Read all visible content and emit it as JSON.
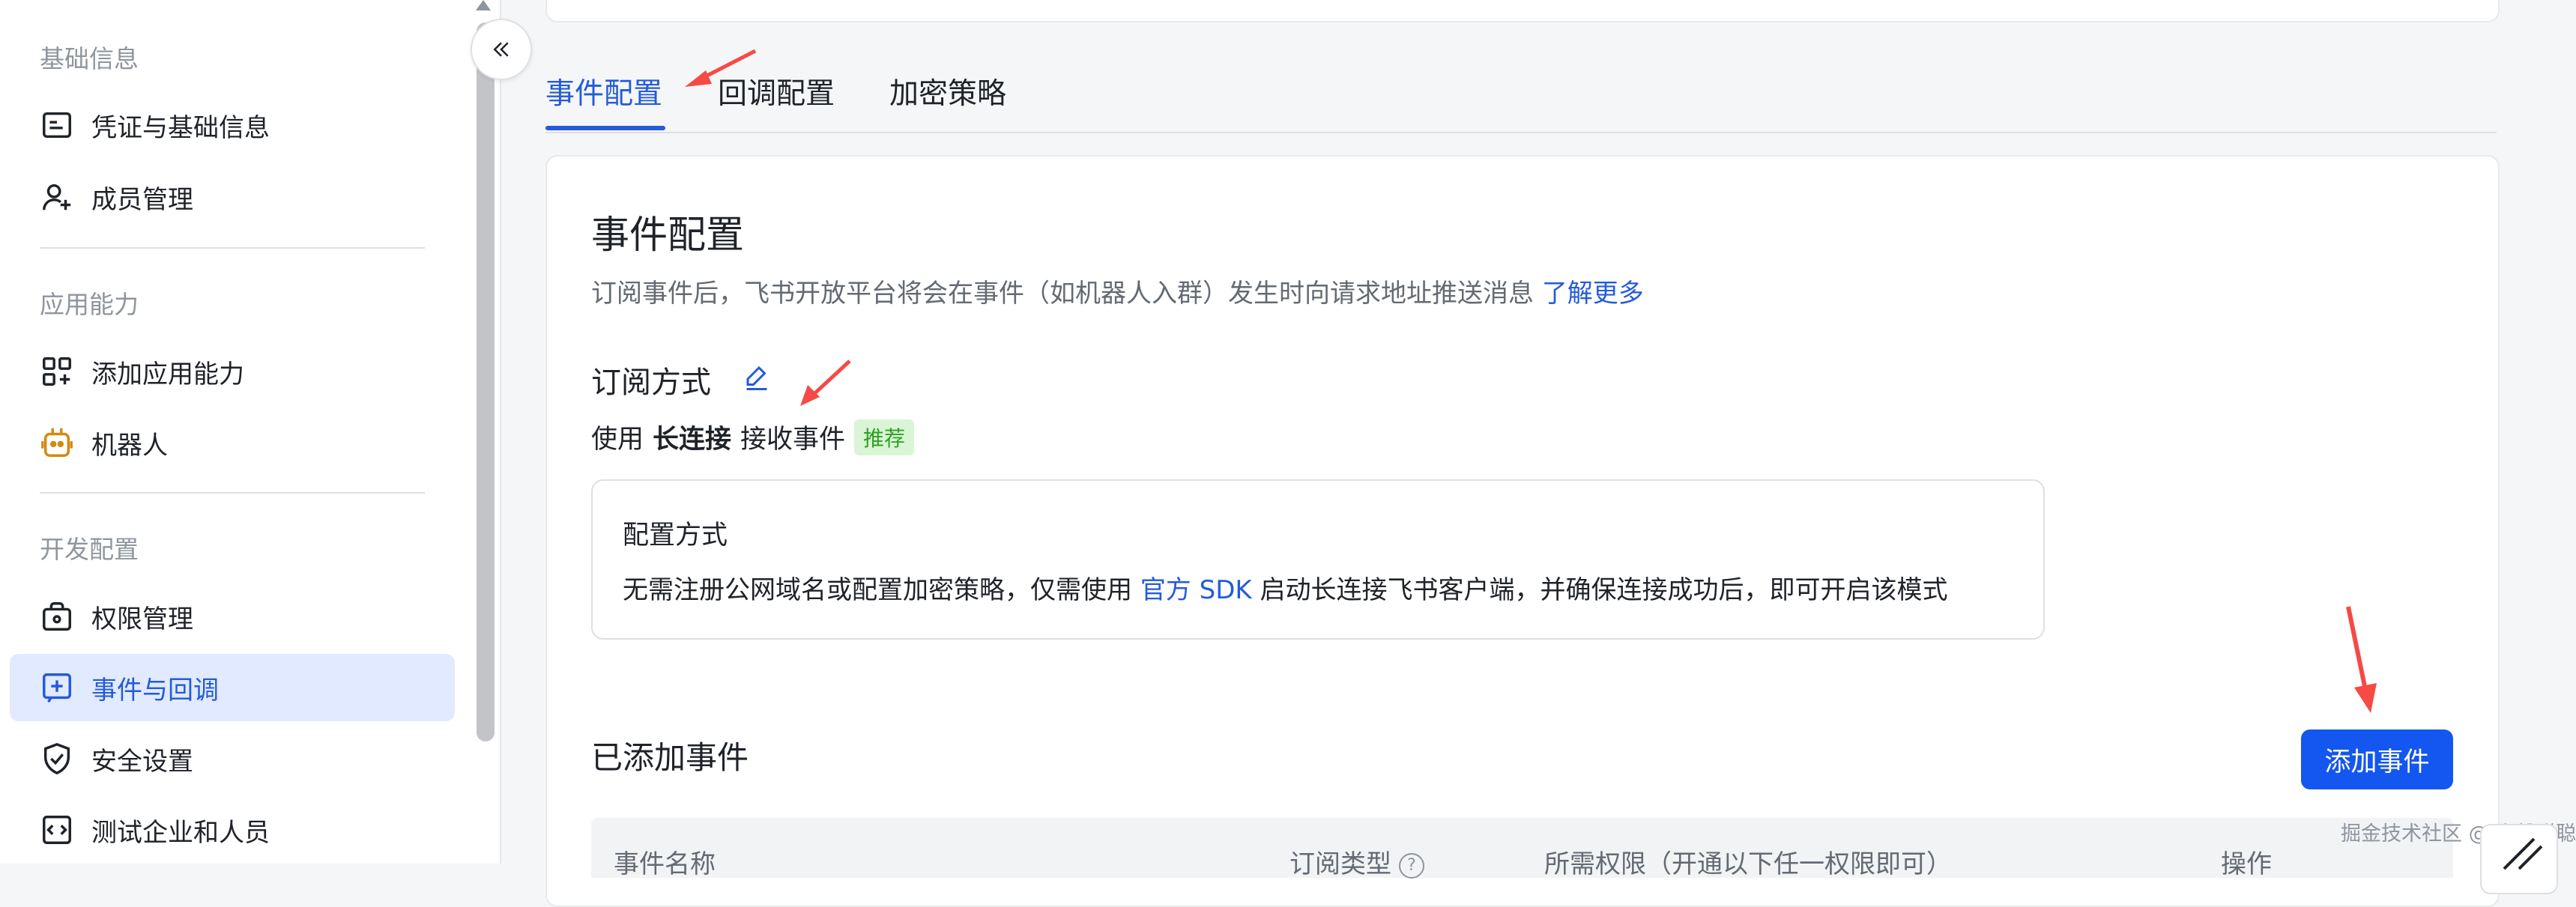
{
  "sidebar": {
    "groups": [
      {
        "title": "基础信息",
        "items": [
          {
            "label": "凭证与基础信息",
            "icon": "credential-icon"
          },
          {
            "label": "成员管理",
            "icon": "add-member-icon"
          }
        ]
      },
      {
        "title": "应用能力",
        "items": [
          {
            "label": "添加应用能力",
            "icon": "add-capability-icon"
          },
          {
            "label": "机器人",
            "icon": "robot-icon"
          }
        ]
      },
      {
        "title": "开发配置",
        "items": [
          {
            "label": "权限管理",
            "icon": "permission-icon"
          },
          {
            "label": "事件与回调",
            "icon": "event-callback-icon",
            "active": true
          },
          {
            "label": "安全设置",
            "icon": "shield-check-icon"
          },
          {
            "label": "测试企业和人员",
            "icon": "code-test-icon"
          }
        ]
      }
    ],
    "collapse_icon": "double-chevron-left-icon"
  },
  "tabs": [
    {
      "label": "事件配置",
      "active": true
    },
    {
      "label": "回调配置"
    },
    {
      "label": "加密策略"
    }
  ],
  "event_config": {
    "title": "事件配置",
    "description": "订阅事件后，飞书开放平台将会在事件（如机器人入群）发生时向请求地址推送消息",
    "learn_more": "了解更多",
    "subscription_label": "订阅方式",
    "using_prefix": "使用",
    "using_method": "长连接",
    "using_suffix": "接收事件",
    "recommend_badge": "推荐",
    "config_box": {
      "title": "配置方式",
      "text_before": "无需注册公网域名或配置加密策略，仅需使用",
      "link": "官方 SDK",
      "text_after": "启动长连接飞书客户端，并确保连接成功后，即可开启该模式"
    }
  },
  "added_events": {
    "title": "已添加事件",
    "add_button": "添加事件",
    "columns": [
      "事件名称",
      "订阅类型",
      "所需权限（开通以下任一权限即可）",
      "操作"
    ],
    "help_icon_text": "?"
  },
  "watermark": "掘金技术社区 @ 小馨聪聪",
  "colors": {
    "accent": "#245bdb",
    "primary_button": "#1456f0",
    "active_nav_bg": "#e1eaff",
    "annotation_arrow": "#f54a45",
    "badge_bg": "#d9f5d6",
    "badge_text": "#2ea121"
  }
}
